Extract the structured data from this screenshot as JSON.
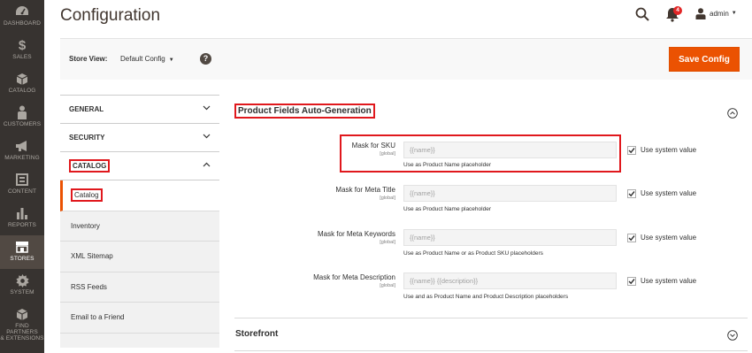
{
  "nav": {
    "items": [
      {
        "label": "DASHBOARD",
        "icon": "dashboard-icon"
      },
      {
        "label": "SALES",
        "icon": "dollar-icon"
      },
      {
        "label": "CATALOG",
        "icon": "cube-icon"
      },
      {
        "label": "CUSTOMERS",
        "icon": "person-icon"
      },
      {
        "label": "MARKETING",
        "icon": "megaphone-icon"
      },
      {
        "label": "CONTENT",
        "icon": "content-icon"
      },
      {
        "label": "REPORTS",
        "icon": "bar-chart-icon"
      },
      {
        "label": "STORES",
        "icon": "store-icon"
      },
      {
        "label": "SYSTEM",
        "icon": "gear-icon"
      },
      {
        "label": "FIND PARTNERS",
        "label2": "& EXTENSIONS",
        "icon": "partners-icon"
      }
    ]
  },
  "header": {
    "title": "Configuration",
    "notifications_count": "4",
    "user": "admin"
  },
  "store_view": {
    "label": "Store View:",
    "value": "Default Config",
    "help": "?",
    "save_label": "Save Config"
  },
  "tabs": {
    "general": "GENERAL",
    "security": "SECURITY",
    "catalog": "CATALOG",
    "items": [
      "Catalog",
      "Inventory",
      "XML Sitemap",
      "RSS Feeds",
      "Email to a Friend"
    ]
  },
  "section": {
    "title": "Product Fields Auto-Generation",
    "rows": [
      {
        "label": "Mask for SKU",
        "scope": "[global]",
        "value": "{{name}}",
        "note": "Use as Product Name placeholder",
        "checkbox_label": "Use system value",
        "checked": true
      },
      {
        "label": "Mask for Meta Title",
        "scope": "[global]",
        "value": "{{name}}",
        "note": "Use as Product Name placeholder",
        "checkbox_label": "Use system value",
        "checked": true
      },
      {
        "label": "Mask for Meta Keywords",
        "scope": "[global]",
        "value": "{{name}}",
        "note": "Use as Product Name or as Product SKU placeholders",
        "checkbox_label": "Use system value",
        "checked": true
      },
      {
        "label": "Mask for Meta Description",
        "scope": "[global]",
        "value": "{{name}} {{description}}",
        "note": "Use and as Product Name and Product Description placeholders",
        "checkbox_label": "Use system value",
        "checked": true
      }
    ]
  },
  "storefront": {
    "title": "Storefront"
  },
  "colors": {
    "accent": "#eb5202",
    "nav_bg": "#373330",
    "highlight": "#e0181d"
  }
}
